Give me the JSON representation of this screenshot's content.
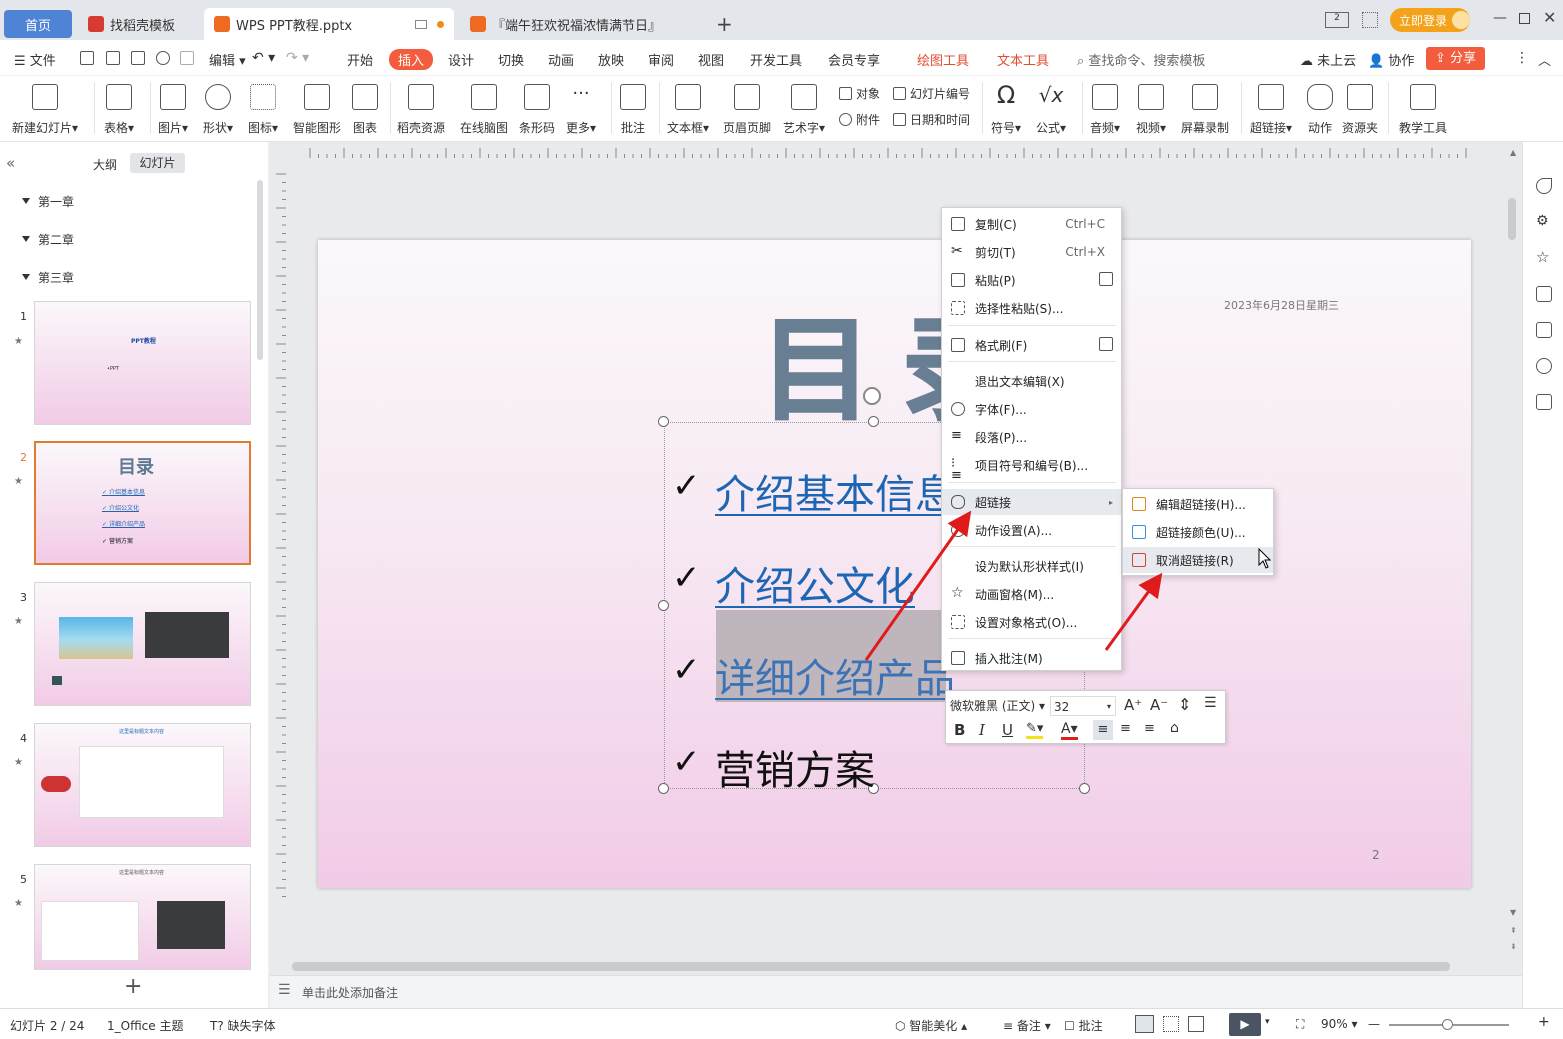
{
  "tabs": {
    "home": "首页",
    "template": "找稻壳模板",
    "doc": "WPS PPT教程.pptx",
    "festival": "『端午狂欢祝福浓情满节日』",
    "login": "立即登录"
  },
  "menu": {
    "file": "文件",
    "edit": "编辑",
    "items": [
      "开始",
      "插入",
      "设计",
      "切换",
      "动画",
      "放映",
      "审阅",
      "视图",
      "开发工具",
      "会员专享"
    ],
    "draw_tools": "绘图工具",
    "text_tools": "文本工具",
    "search": "查找命令、搜索模板",
    "cloud": "未上云",
    "collab": "协作",
    "share": "分享"
  },
  "ribbon": {
    "new_slide": "新建幻灯片",
    "table": "表格",
    "picture": "图片",
    "shape": "形状",
    "icon": "图标",
    "smart_graphic": "智能图形",
    "chart": "图表",
    "docer": "稻壳资源",
    "mindmap": "在线脑图",
    "barcode": "条形码",
    "more": "更多",
    "comment": "批注",
    "textbox": "文本框",
    "header_footer": "页眉页脚",
    "wordart": "艺术字",
    "object": "对象",
    "attachment": "附件",
    "slide_number": "幻灯片编号",
    "datetime": "日期和时间",
    "symbol": "符号",
    "formula": "公式",
    "audio": "音频",
    "video": "视频",
    "screen_record": "屏幕录制",
    "hyperlink": "超链接",
    "action": "动作",
    "resource": "资源夹",
    "teaching": "教学工具"
  },
  "left_panel": {
    "outline_tab": "大纲",
    "slides_tab": "幻灯片",
    "chapters": [
      "第一章",
      "第二章",
      "第三章"
    ],
    "thumbs": [
      {
        "num": "1",
        "title": "PPT教程",
        "sub": "•PPT"
      },
      {
        "num": "2",
        "title": "目录",
        "items": [
          "介绍基本信息",
          "介绍公文化",
          "详细介绍产品",
          "营销方案"
        ]
      },
      {
        "num": "3"
      },
      {
        "num": "4",
        "title": "这里是标题文本内容"
      },
      {
        "num": "5",
        "title": "这里是标题文本内容"
      }
    ]
  },
  "slide": {
    "title": "目录",
    "date": "2023年6月28日星期三",
    "page_num": "2",
    "bullets": [
      "介绍基本信息",
      "介绍公文化",
      "详细介绍产品",
      "营销方案"
    ]
  },
  "context_menu": {
    "copy": "复制(C)",
    "copy_key": "Ctrl+C",
    "cut": "剪切(T)",
    "cut_key": "Ctrl+X",
    "paste": "粘贴(P)",
    "paste_special": "选择性粘贴(S)...",
    "format_painter": "格式刷(F)",
    "exit_edit": "退出文本编辑(X)",
    "font": "字体(F)...",
    "paragraph": "段落(P)...",
    "bullets": "项目符号和编号(B)...",
    "hyperlink": "超链接",
    "action": "动作设置(A)...",
    "default_style": "设为默认形状样式(I)",
    "anim_pane": "动画窗格(M)...",
    "format_object": "设置对象格式(O)...",
    "insert_comment": "插入批注(M)"
  },
  "submenu": {
    "edit_link": "编辑超链接(H)...",
    "link_color": "超链接颜色(U)...",
    "remove_link": "取消超链接(R)"
  },
  "mini_toolbar": {
    "font": "微软雅黑 (正文)",
    "size": "32"
  },
  "notes_placeholder": "单击此处添加备注",
  "status": {
    "slide_pos": "幻灯片 2 / 24",
    "theme": "1_Office 主题",
    "missing_font": "缺失字体",
    "beautify": "智能美化",
    "notes": "备注",
    "comments": "批注",
    "zoom": "90%"
  },
  "colors": {
    "accent": "#f45c3e",
    "link": "#1e66b4",
    "home_tab": "#4e83d6",
    "arrow": "#e01b1b"
  }
}
